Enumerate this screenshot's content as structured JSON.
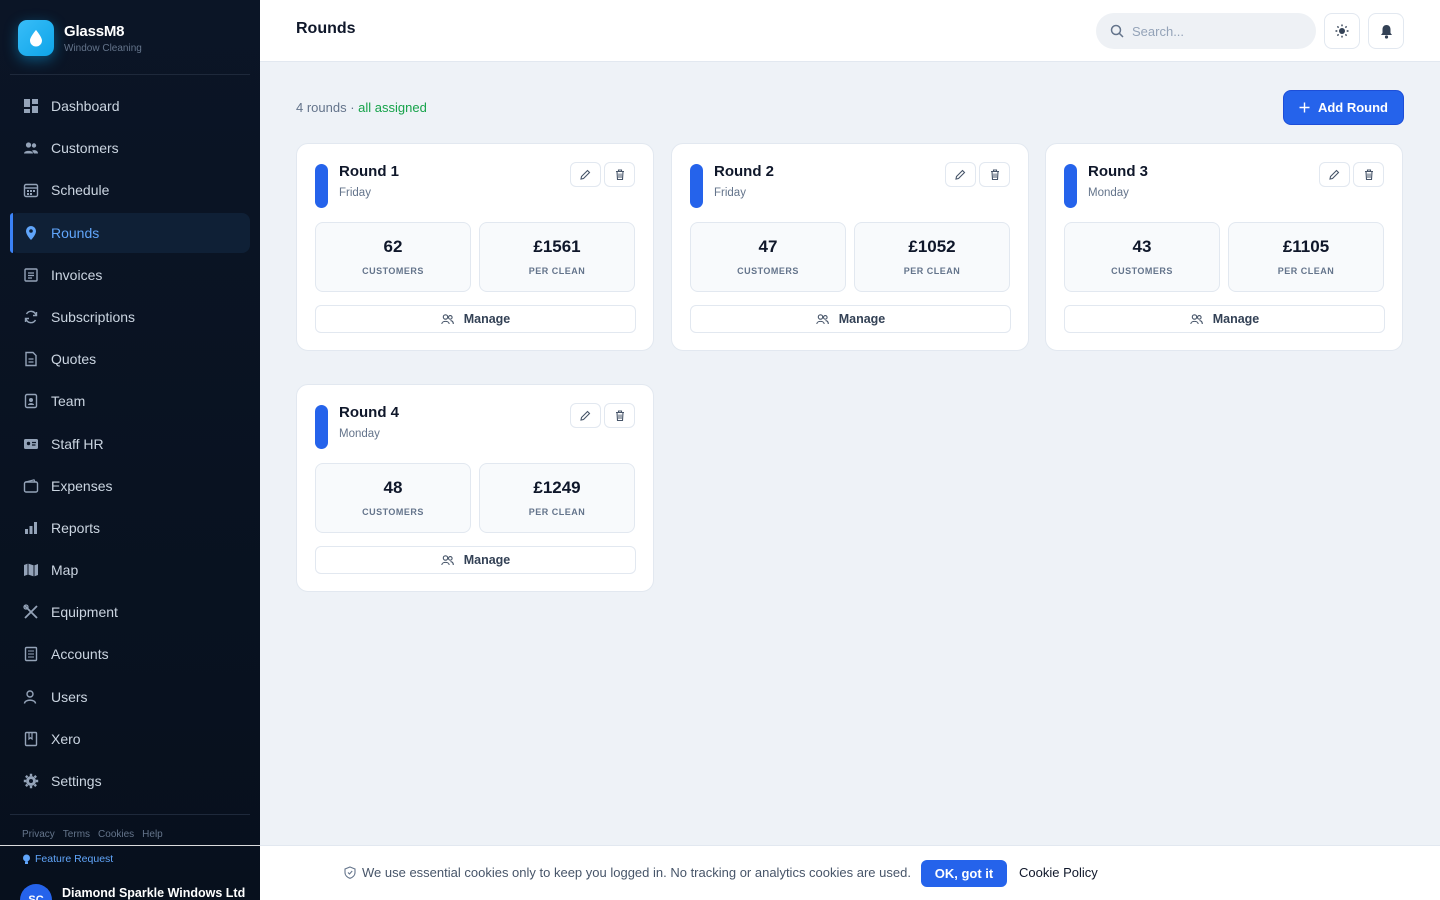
{
  "brand": {
    "name": "GlassM8",
    "subtitle": "Window Cleaning"
  },
  "nav": [
    {
      "label": "Dashboard",
      "icon": "dashboard-icon"
    },
    {
      "label": "Customers",
      "icon": "users-icon"
    },
    {
      "label": "Schedule",
      "icon": "calendar-icon"
    },
    {
      "label": "Rounds",
      "icon": "map-pin-icon",
      "active": true
    },
    {
      "label": "Invoices",
      "icon": "invoice-icon"
    },
    {
      "label": "Subscriptions",
      "icon": "refresh-icon"
    },
    {
      "label": "Quotes",
      "icon": "document-icon"
    },
    {
      "label": "Team",
      "icon": "badge-icon"
    },
    {
      "label": "Staff HR",
      "icon": "id-card-icon"
    },
    {
      "label": "Expenses",
      "icon": "wallet-icon"
    },
    {
      "label": "Reports",
      "icon": "bar-chart-icon"
    },
    {
      "label": "Map",
      "icon": "map-icon"
    },
    {
      "label": "Equipment",
      "icon": "tools-icon"
    },
    {
      "label": "Accounts",
      "icon": "ledger-icon"
    },
    {
      "label": "Users",
      "icon": "user-icon"
    },
    {
      "label": "Xero",
      "icon": "book-icon"
    },
    {
      "label": "Settings",
      "icon": "gear-icon"
    }
  ],
  "footer_links": [
    "Privacy",
    "Terms",
    "Cookies",
    "Help"
  ],
  "feature_request": "Feature Request",
  "account": {
    "initials": "SC",
    "name": "Diamond Sparkle Windows Ltd"
  },
  "header": {
    "title": "Rounds",
    "search_placeholder": "Search..."
  },
  "summary": {
    "count": "4 rounds",
    "separator": " · ",
    "status": "all assigned"
  },
  "add_button": "Add Round",
  "rounds": [
    {
      "name": "Round 1",
      "day": "Friday",
      "customers": "62",
      "customers_label": "CUSTOMERS",
      "per_clean": "£1561",
      "per_clean_label": "PER CLEAN",
      "manage": "Manage"
    },
    {
      "name": "Round 2",
      "day": "Friday",
      "customers": "47",
      "customers_label": "CUSTOMERS",
      "per_clean": "£1052",
      "per_clean_label": "PER CLEAN",
      "manage": "Manage"
    },
    {
      "name": "Round 3",
      "day": "Monday",
      "customers": "43",
      "customers_label": "CUSTOMERS",
      "per_clean": "£1105",
      "per_clean_label": "PER CLEAN",
      "manage": "Manage"
    },
    {
      "name": "Round 4",
      "day": "Monday",
      "customers": "48",
      "customers_label": "CUSTOMERS",
      "per_clean": "£1249",
      "per_clean_label": "PER CLEAN",
      "manage": "Manage"
    }
  ],
  "cookie": {
    "text": "We use essential cookies only to keep you logged in. No tracking or analytics cookies are used.",
    "ok": "OK, got it",
    "policy": "Cookie Policy"
  },
  "colors": {
    "accent": "#2563eb",
    "sidebar": "#0b1526",
    "success": "#16a34a",
    "active_nav": "#60a5fa"
  }
}
